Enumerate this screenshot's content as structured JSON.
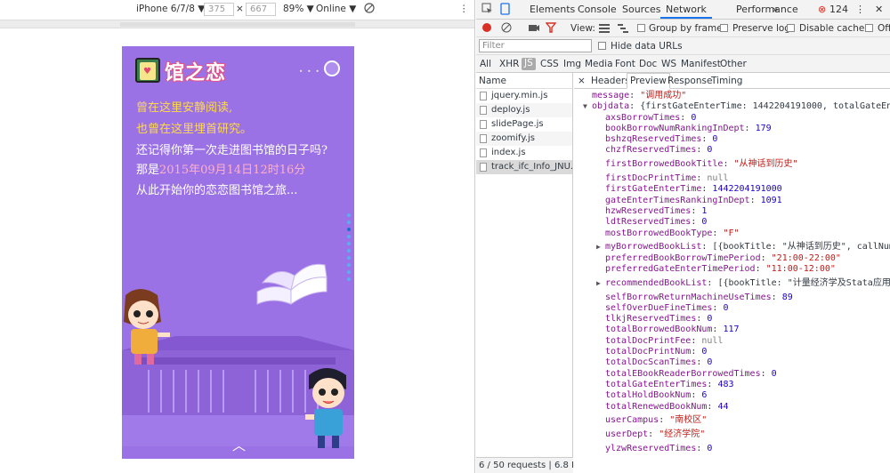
{
  "device_toolbar": {
    "device": "iPhone 6/7/8 ▼",
    "width": "375",
    "x": "×",
    "height": "667",
    "zoom": "89% ▼",
    "throttle": "Online ▼"
  },
  "phone": {
    "title": "馆之恋",
    "lines": [
      {
        "text": "曾在这里安静阅读,",
        "style": "yl"
      },
      {
        "text": "也曾在这里埋首研究。",
        "style": "yl"
      },
      {
        "text": "还记得你第一次走进图书馆的日子吗?",
        "style": ""
      }
    ],
    "date_prefix": "那是",
    "date_value": "2015年09月14日12时16分",
    "last_line": "从此开始你的恋恋图书馆之旅...",
    "up_arrow": "︿"
  },
  "devtools": {
    "tabs": [
      "Elements",
      "Console",
      "Sources",
      "Network",
      "Performance",
      "»"
    ],
    "active_tab": "Network",
    "error_count": "124",
    "toolbar": {
      "view_label": "View:",
      "group_by_frame": "Group by frame",
      "preserve_log": "Preserve log",
      "disable_cache": "Disable cache",
      "offline": "Off"
    },
    "filter_placeholder": "Filter",
    "hide_data_urls": "Hide data URLs",
    "types": [
      "All",
      "XHR",
      "JS",
      "CSS",
      "Img",
      "Media",
      "Font",
      "Doc",
      "WS",
      "Manifest",
      "Other"
    ],
    "selected_type": "JS",
    "name_header": "Name",
    "requests": [
      "jquery.min.js",
      "deploy.js",
      "slidePage.js",
      "zoomify.js",
      "index.js",
      "track_ifc_Info_JNU..."
    ],
    "footer": "6 / 50 requests | 6.8 K...",
    "detail_tabs": [
      "×",
      "Headers",
      "Preview",
      "Response",
      "Timing"
    ],
    "active_detail_tab": "Preview"
  },
  "json_preview": [
    {
      "indent": 0,
      "key": "message",
      "value": "\"调用成功\"",
      "type": "s"
    },
    {
      "indent": 0,
      "key": "objdata",
      "value": "{firstGateEnterTime: 1442204191000, totalGateEnter",
      "type": "o",
      "tri": "▼"
    },
    {
      "indent": 1,
      "key": "axsBorrowTimes",
      "value": "0",
      "type": "n"
    },
    {
      "indent": 1,
      "key": "bookBorrowNumRankingInDept",
      "value": "179",
      "type": "n"
    },
    {
      "indent": 1,
      "key": "bshzqReservedTimes",
      "value": "0",
      "type": "n"
    },
    {
      "indent": 1,
      "key": "chzfReservedTimes",
      "value": "0",
      "type": "n"
    },
    {
      "indent": 1,
      "key": "firstBorrowedBookTitle",
      "value": "\"从神话到历史\"",
      "type": "s",
      "gap": true
    },
    {
      "indent": 1,
      "key": "firstDocPrintTime",
      "value": "null",
      "type": "nl",
      "gap": true
    },
    {
      "indent": 1,
      "key": "firstGateEnterTime",
      "value": "1442204191000",
      "type": "n"
    },
    {
      "indent": 1,
      "key": "gateEnterTimesRankingInDept",
      "value": "1091",
      "type": "n"
    },
    {
      "indent": 1,
      "key": "hzwReservedTimes",
      "value": "1",
      "type": "n"
    },
    {
      "indent": 1,
      "key": "ldtReservedTimes",
      "value": "0",
      "type": "n"
    },
    {
      "indent": 1,
      "key": "mostBorrowedBookType",
      "value": "\"F\"",
      "type": "s"
    },
    {
      "indent": 1,
      "key": "myBorrowedBookList",
      "value": "[{bookTitle: \"从神话到历史\", callNumber",
      "type": "o",
      "tri": "▶",
      "gap": true
    },
    {
      "indent": 1,
      "key": "preferredBookBorrowTimePeriod",
      "value": "\"21:00-22:00\"",
      "type": "s"
    },
    {
      "indent": 1,
      "key": "preferredGateEnterTimePeriod",
      "value": "\"11:00-12:00\"",
      "type": "s"
    },
    {
      "indent": 1,
      "key": "recommendedBookList",
      "value": "[{bookTitle: \"计量经济学及Stata应用\", c",
      "type": "o",
      "tri": "▶",
      "gap": true
    },
    {
      "indent": 1,
      "key": "selfBorrowReturnMachineUseTimes",
      "value": "89",
      "type": "n",
      "gap": true
    },
    {
      "indent": 1,
      "key": "selfOverDueFineTimes",
      "value": "0",
      "type": "n"
    },
    {
      "indent": 1,
      "key": "tlkjReservedTimes",
      "value": "0",
      "type": "n"
    },
    {
      "indent": 1,
      "key": "totalBorrowedBookNum",
      "value": "117",
      "type": "n"
    },
    {
      "indent": 1,
      "key": "totalDocPrintFee",
      "value": "null",
      "type": "nl"
    },
    {
      "indent": 1,
      "key": "totalDocPrintNum",
      "value": "0",
      "type": "n"
    },
    {
      "indent": 1,
      "key": "totalDocScanTimes",
      "value": "0",
      "type": "n"
    },
    {
      "indent": 1,
      "key": "totalEBookReaderBorrowedTimes",
      "value": "0",
      "type": "n"
    },
    {
      "indent": 1,
      "key": "totalGateEnterTimes",
      "value": "483",
      "type": "n"
    },
    {
      "indent": 1,
      "key": "totalHoldBookNum",
      "value": "6",
      "type": "n"
    },
    {
      "indent": 1,
      "key": "totalRenewedBookNum",
      "value": "44",
      "type": "n"
    },
    {
      "indent": 1,
      "key": "userCampus",
      "value": "\"南校区\"",
      "type": "s",
      "gap": true
    },
    {
      "indent": 1,
      "key": "userDept",
      "value": "\"经济学院\"",
      "type": "s",
      "gap": true
    },
    {
      "indent": 1,
      "key": "ylzwReservedTimes",
      "value": "0",
      "type": "n",
      "gap": true
    }
  ],
  "colors": {
    "phone_bg": "#9b72e6",
    "accent": "#1a73e8",
    "json_key": "#881391",
    "json_string": "#c41a16",
    "json_number": "#1c00cf"
  }
}
